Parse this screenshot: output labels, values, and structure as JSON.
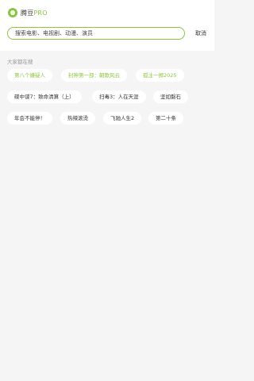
{
  "app": {
    "name_prefix": "腾豆",
    "name_suffix": "PRO"
  },
  "search": {
    "placeholder": "搜索电影、电视剧、动漫、演员",
    "value": "",
    "cancel_label": "取消"
  },
  "trending": {
    "title": "大家都在搜",
    "tags": [
      {
        "label": "第八个嫌疑人",
        "hot": true
      },
      {
        "label": "封神第一部：朝歌风云",
        "hot": true
      },
      {
        "label": "孤注一掷2025",
        "hot": true
      },
      {
        "label": "碟中谍7：致命清算（上）",
        "hot": false
      },
      {
        "label": "扫毒3：人在天涯",
        "hot": false
      },
      {
        "label": "坚如磐石",
        "hot": false
      },
      {
        "label": "年会不能停！",
        "hot": false
      },
      {
        "label": "热辣滚烫",
        "hot": false
      },
      {
        "label": "飞驰人生2",
        "hot": false
      },
      {
        "label": "第二十条",
        "hot": false
      }
    ]
  },
  "colors": {
    "accent": "#8cc63f",
    "background": "#f5f5f5",
    "muted_text": "#999999"
  }
}
